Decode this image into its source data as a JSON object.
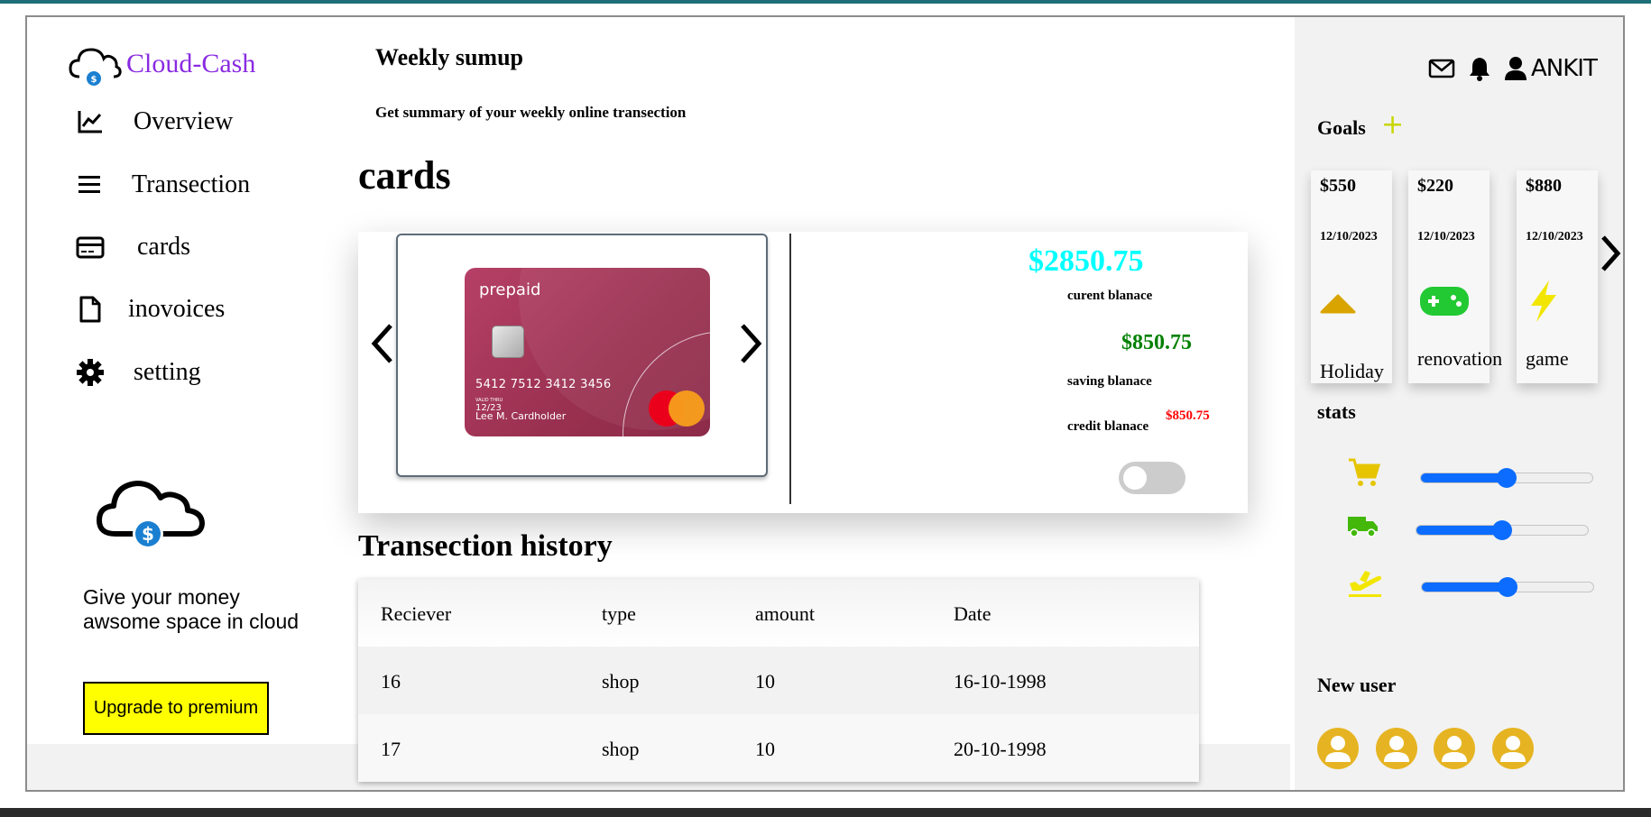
{
  "app": {
    "name": "Cloud-Cash"
  },
  "sidebar": {
    "items": [
      {
        "label": "Overview",
        "icon": "chart-line-icon"
      },
      {
        "label": "Transection",
        "icon": "menu-icon"
      },
      {
        "label": "cards",
        "icon": "credit-card-icon"
      },
      {
        "label": "inovoices",
        "icon": "file-icon"
      },
      {
        "label": "setting",
        "icon": "gear-icon"
      }
    ],
    "promo_text": "Give your money awsome space in cloud",
    "upgrade_label": "Upgrade to premium"
  },
  "main": {
    "weekly_title": "Weekly sumup",
    "weekly_subtitle": "Get summary of your weekly online transection",
    "cards_title": "cards",
    "card": {
      "brand_label": "prepaid",
      "number": "5412 7512 3412 3456",
      "valid_label": "VALID THRU",
      "expiry": "12/23",
      "holder": "Lee M. Cardholder"
    },
    "balances": {
      "current_value": "$2850.75",
      "current_label": "curent blanace",
      "saving_value": "$850.75",
      "saving_label": "saving blanace",
      "credit_value": "$850.75",
      "credit_label": "credit blanace"
    },
    "history": {
      "title": "Transection history",
      "columns": [
        "Reciever",
        "type",
        "amount",
        "Date"
      ],
      "rows": [
        [
          "16",
          "shop",
          "10",
          "16-10-1998"
        ],
        [
          "17",
          "shop",
          "10",
          "20-10-1998"
        ]
      ]
    }
  },
  "right": {
    "user_name": "ANKIT",
    "goals_title": "Goals",
    "goals_add": "+",
    "goals": [
      {
        "amount": "$550",
        "date": "12/10/2023",
        "name": "Holiday",
        "icon": "cap-icon"
      },
      {
        "amount": "$220",
        "date": "12/10/2023",
        "name": "renovation",
        "icon": "gamepad-icon"
      },
      {
        "amount": "$880",
        "date": "12/10/2023",
        "name": "game",
        "icon": "lightning-icon"
      }
    ],
    "stats_title": "stats",
    "stats": [
      {
        "icon": "cart-icon",
        "value": 0.5
      },
      {
        "icon": "truck-icon",
        "value": 0.5
      },
      {
        "icon": "plane-icon",
        "value": 0.5
      }
    ],
    "new_user_title": "New user"
  },
  "colors": {
    "brand": "#8a2be2",
    "current_balance": "#00ffff",
    "saving_balance": "#008000",
    "credit_balance": "#ff0000",
    "upgrade_button": "#ffff00",
    "slider": "#0b6cff",
    "avatar": "#e6b422"
  }
}
